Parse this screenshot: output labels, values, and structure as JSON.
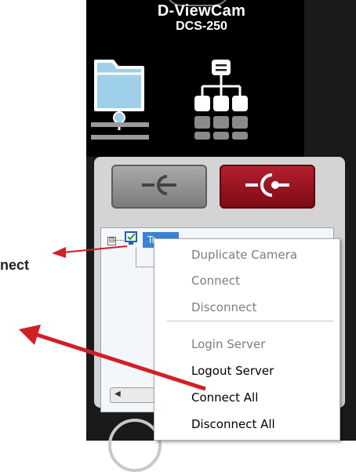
{
  "app": {
    "brand_line1": "D-ViewCam",
    "brand_line2": "DCS-250"
  },
  "icons": {
    "local_tree": "folder-network-icon",
    "server_tree": "network-hierarchy-icon",
    "disconnect_button_icon": "plug-icon",
    "connect_button_icon": "plug-icon"
  },
  "tree": {
    "root_toggle": "⊟",
    "root_label": "Tr..."
  },
  "context_menu": {
    "items": [
      {
        "label": "Duplicate Camera",
        "enabled": false
      },
      {
        "label": "Connect",
        "enabled": false
      },
      {
        "label": "Disconnect",
        "enabled": false
      },
      {
        "label": "Login Server",
        "enabled": false
      },
      {
        "label": "Logout Server",
        "enabled": true
      },
      {
        "label": "Connect All",
        "enabled": true
      },
      {
        "label": "Disconnect All",
        "enabled": true
      }
    ]
  },
  "annotations": {
    "callout_text": "nect"
  },
  "colors": {
    "accent_red": "#8f1320",
    "arrow_red": "#d11f26",
    "selection_blue": "#3b82d6"
  }
}
